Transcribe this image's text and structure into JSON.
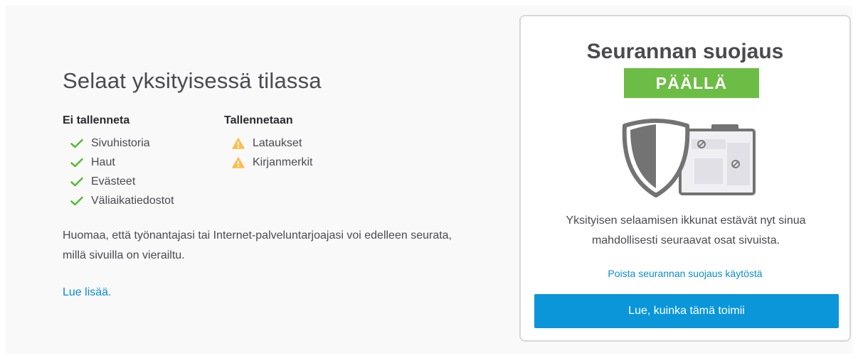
{
  "private": {
    "title": "Selaat yksityisessä tilassa",
    "not_saved": {
      "heading": "Ei tallenneta",
      "items": [
        "Sivuhistoria",
        "Haut",
        "Evästeet",
        "Väliaikatiedostot"
      ]
    },
    "saved": {
      "heading": "Tallennetaan",
      "items": [
        "Lataukset",
        "Kirjanmerkit"
      ]
    },
    "notice": "Huomaa, että työnantajasi tai Internet-palveluntarjoajasi voi edelleen seurata, millä sivuilla on vierailtu.",
    "learn_more": "Lue lisää."
  },
  "tracking": {
    "title": "Seurannan suojaus",
    "status": "PÄÄLLÄ",
    "description": "Yksityisen selaamisen ikkunat estävät nyt sinua mahdollisesti seuraavat osat sivuista.",
    "disable_link": "Poista seurannan suojaus käytöstä",
    "how_button": "Lue, kuinka tämä toimii"
  },
  "colors": {
    "accent": "#0a8dd1",
    "button": "#0a96d9",
    "status_on": "#6cbd45",
    "check": "#57bd35",
    "warning": "#ffbd4f"
  },
  "icons": {
    "not_saved_item": "checkmark-icon",
    "saved_item": "warning-icon",
    "illustration": "shield-blocked-content-icon"
  }
}
